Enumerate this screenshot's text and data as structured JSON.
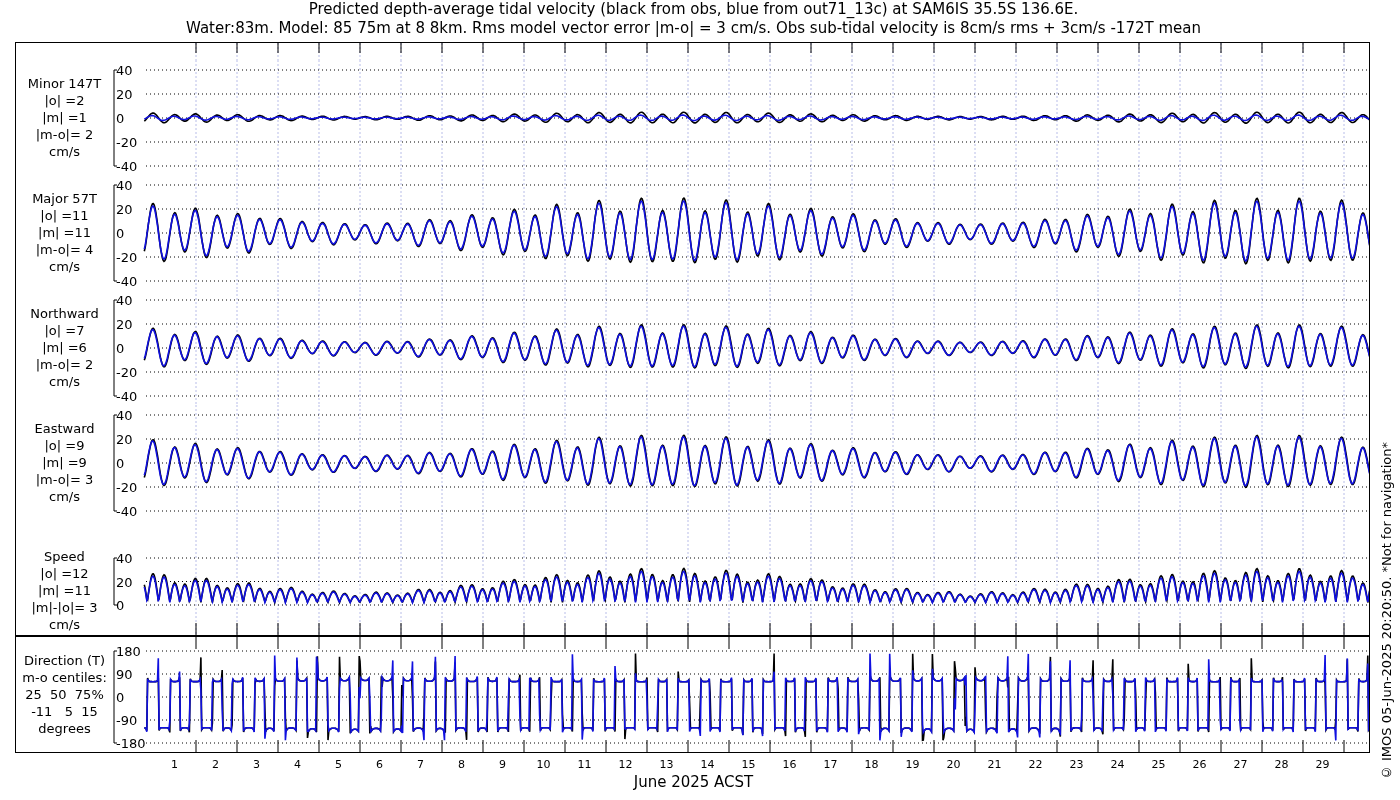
{
  "title_lines": [
    "Predicted depth-average tidal velocity (black from obs, blue from out71_13c) at SAM6IS 35.5S 136.6E.",
    "Water:83m. Model: 85 75m at 8 8km. Rms model vector error |m-o| = 3 cm/s. Obs sub-tidal velocity is 8cm/s rms + 3cm/s -172T mean"
  ],
  "panels": [
    {
      "kind": "signed",
      "label_lines": [
        "Minor 147T",
        "|o| =2",
        "|m| =1",
        "|m-o|= 2",
        "cm/s"
      ],
      "yticks": [
        "40",
        "20",
        "0",
        "-20",
        "-40"
      ]
    },
    {
      "kind": "signed",
      "label_lines": [
        "Major 57T",
        "|o| =11",
        "|m| =11",
        "|m-o|= 4",
        "cm/s"
      ],
      "yticks": [
        "40",
        "20",
        "0",
        "-20",
        "-40"
      ]
    },
    {
      "kind": "signed",
      "label_lines": [
        "Northward",
        "|o| =7",
        "|m| =6",
        "|m-o|= 2",
        "cm/s"
      ],
      "yticks": [
        "40",
        "20",
        "0",
        "-20",
        "-40"
      ]
    },
    {
      "kind": "signed",
      "label_lines": [
        "Eastward",
        "|o| =9",
        "|m| =9",
        "|m-o|= 3",
        "cm/s"
      ],
      "yticks": [
        "40",
        "20",
        "0",
        "-20",
        "-40"
      ]
    },
    {
      "kind": "speed",
      "label_lines": [
        "Speed",
        "|o| =12",
        "|m| =11",
        "|m|-|o|= 3",
        "cm/s"
      ],
      "yticks": [
        "40",
        "20",
        "0"
      ]
    },
    {
      "kind": "direction",
      "label_lines": [
        "Direction (T)",
        "m-o centiles:",
        "25  50  75%",
        "-11   5  15",
        "degrees"
      ],
      "yticks": [
        "180",
        "90",
        "0",
        "-90",
        "-180"
      ]
    }
  ],
  "xticks": [
    "1",
    "2",
    "3",
    "4",
    "5",
    "6",
    "7",
    "8",
    "9",
    "10",
    "11",
    "12",
    "13",
    "14",
    "15",
    "16",
    "17",
    "18",
    "19",
    "20",
    "21",
    "22",
    "23",
    "24",
    "25",
    "26",
    "27",
    "28",
    "29"
  ],
  "xlabel": "June 2025 ACST",
  "copyright": "© IMOS 05-Jun-2025 20:20:50. *Not for navigation*"
}
